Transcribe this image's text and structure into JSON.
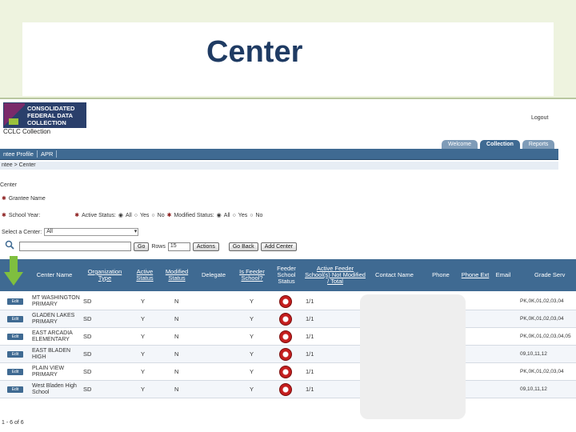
{
  "slide": {
    "title": "Center"
  },
  "header": {
    "logo_lines": [
      "CONSOLIDATED",
      "FEDERAL DATA",
      "COLLECTION"
    ],
    "app_name": "CCLC Collection",
    "logout": "Logout",
    "tabs": [
      "Welcome",
      "Collection",
      "Reports"
    ],
    "active_tab": "Collection"
  },
  "nav": {
    "items": [
      "ntee Profile",
      "APR"
    ]
  },
  "breadcrumb": "ntee > Center",
  "section_title": "Center",
  "filters": {
    "grantee_name_label": "Grantee Name",
    "school_year_label": "School Year:",
    "active_status_label": "Active Status:",
    "modified_status_label": "Modified Status:",
    "options": [
      "All",
      "Yes",
      "No"
    ],
    "select_center_label": "Select a Center:",
    "select_center_value": "All"
  },
  "toolbar": {
    "go_label": "Go",
    "rows_label": "Rows",
    "rows_value": "15",
    "actions_label": "Actions",
    "go_back_label": "Go Back",
    "add_center_label": "Add Center"
  },
  "table": {
    "headers": [
      "Center Name",
      "Organization Type",
      "Active Status",
      "Modified Status",
      "Delegate",
      "Is Feeder School?",
      "Feeder School Status",
      "Active Feeder School(s) Not Modified / Total",
      "Contact Name",
      "Phone",
      "Phone Ext",
      "Email",
      "Grade Serv"
    ],
    "edit_label": "Edit",
    "rows": [
      {
        "name": "MT WASHINGTON PRIMARY",
        "org": "SD",
        "active": "Y",
        "modified": "N",
        "feeder": "Y",
        "ratio": "1/1",
        "grades": "PK,0K,01,02,03,04"
      },
      {
        "name": "GLADEN LAKES PRIMARY",
        "org": "SD",
        "active": "Y",
        "modified": "N",
        "feeder": "Y",
        "ratio": "1/1",
        "grades": "PK,0K,01,02,03,04"
      },
      {
        "name": "EAST ARCADIA ELEMENTARY",
        "org": "SD",
        "active": "Y",
        "modified": "N",
        "feeder": "Y",
        "ratio": "1/1",
        "grades": "PK,0K,01,02,03,04,05"
      },
      {
        "name": "EAST BLADEN HIGH",
        "org": "SD",
        "active": "Y",
        "modified": "N",
        "feeder": "Y",
        "ratio": "1/1",
        "grades": "09,10,11,12"
      },
      {
        "name": "PLAIN VIEW PRIMARY",
        "org": "SD",
        "active": "Y",
        "modified": "N",
        "feeder": "Y",
        "ratio": "1/1",
        "grades": "PK,0K,01,02,03,04"
      },
      {
        "name": "West Bladen High School",
        "org": "SD",
        "active": "Y",
        "modified": "N",
        "feeder": "Y",
        "ratio": "1/1",
        "grades": "09,10,11,12"
      }
    ]
  },
  "footer": "1 - 6 of 6",
  "colors": {
    "nav_blue": "#3f6a92",
    "title_navy": "#1f3b63",
    "status_red": "#c41e1e",
    "arrow_green": "#7fbf3f"
  },
  "icons": [
    "magnifier-icon",
    "arrow-down-icon",
    "status-icon"
  ]
}
